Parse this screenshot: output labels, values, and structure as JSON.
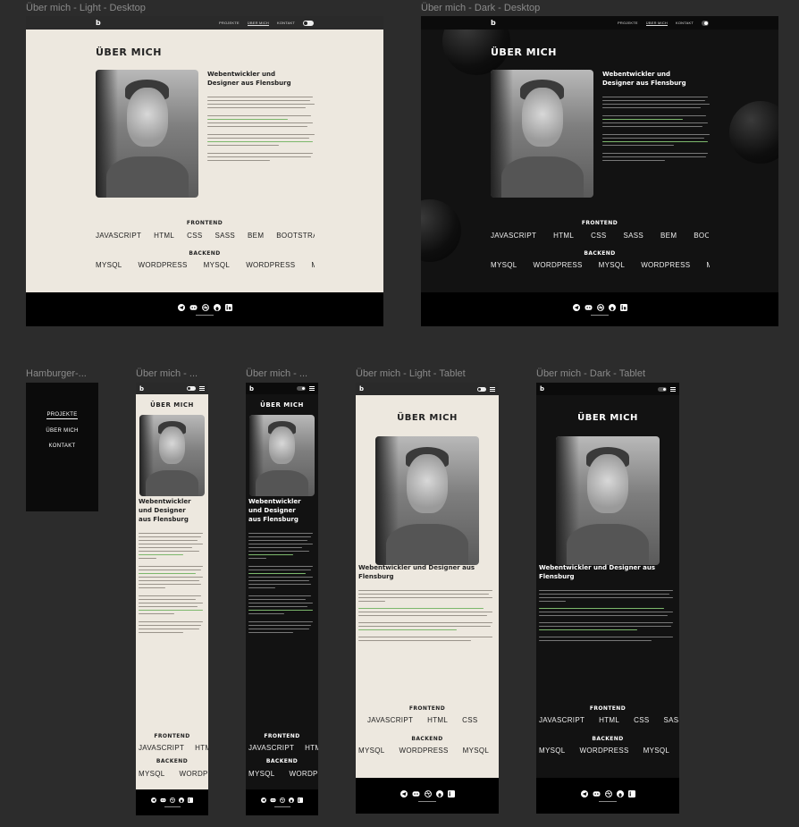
{
  "frames": {
    "desktop_light": "Über mich - Light - Desktop",
    "desktop_dark": "Über mich - Dark - Desktop",
    "hamburger": "Hamburger-...",
    "mobile_light": "Über mich - ...",
    "mobile_dark": "Über mich - ...",
    "tablet_light": "Über mich - Light - Tablet",
    "tablet_dark": "Über mich - Dark - Tablet"
  },
  "nav": {
    "logo": "b",
    "projects": "PROJEKTE",
    "about": "ÜBER MICH",
    "contact": "KONTAKT"
  },
  "page": {
    "title": "ÜBER MICH",
    "heading_line1": "Webentwickler und",
    "heading_line2": "Designer aus Flensburg",
    "heading_tablet": "Webentwickler und Designer aus Flensburg",
    "heading_mobile_1": "Webentwickler",
    "heading_mobile_2": "und Designer",
    "heading_mobile_3": "aus Flensburg",
    "frontend": "FRONTEND",
    "backend": "BACKEND",
    "frontend_tags": [
      "JAVASCRIPT",
      "HTML",
      "CSS",
      "SASS",
      "BEM",
      "BOOTSTRAP"
    ],
    "backend_tags": [
      "MYSQL",
      "WORDPRESS",
      "MYSQL",
      "WORDPRESS",
      "M"
    ]
  },
  "footer": {
    "icons": [
      "telegram-icon",
      "discord-icon",
      "dribbble-icon",
      "github-icon",
      "linkedin-icon"
    ]
  },
  "colors": {
    "light_bg": "#ede8df",
    "dark_bg": "#121212",
    "canvas": "#2c2c2c",
    "link_green": "#7cb86c"
  }
}
